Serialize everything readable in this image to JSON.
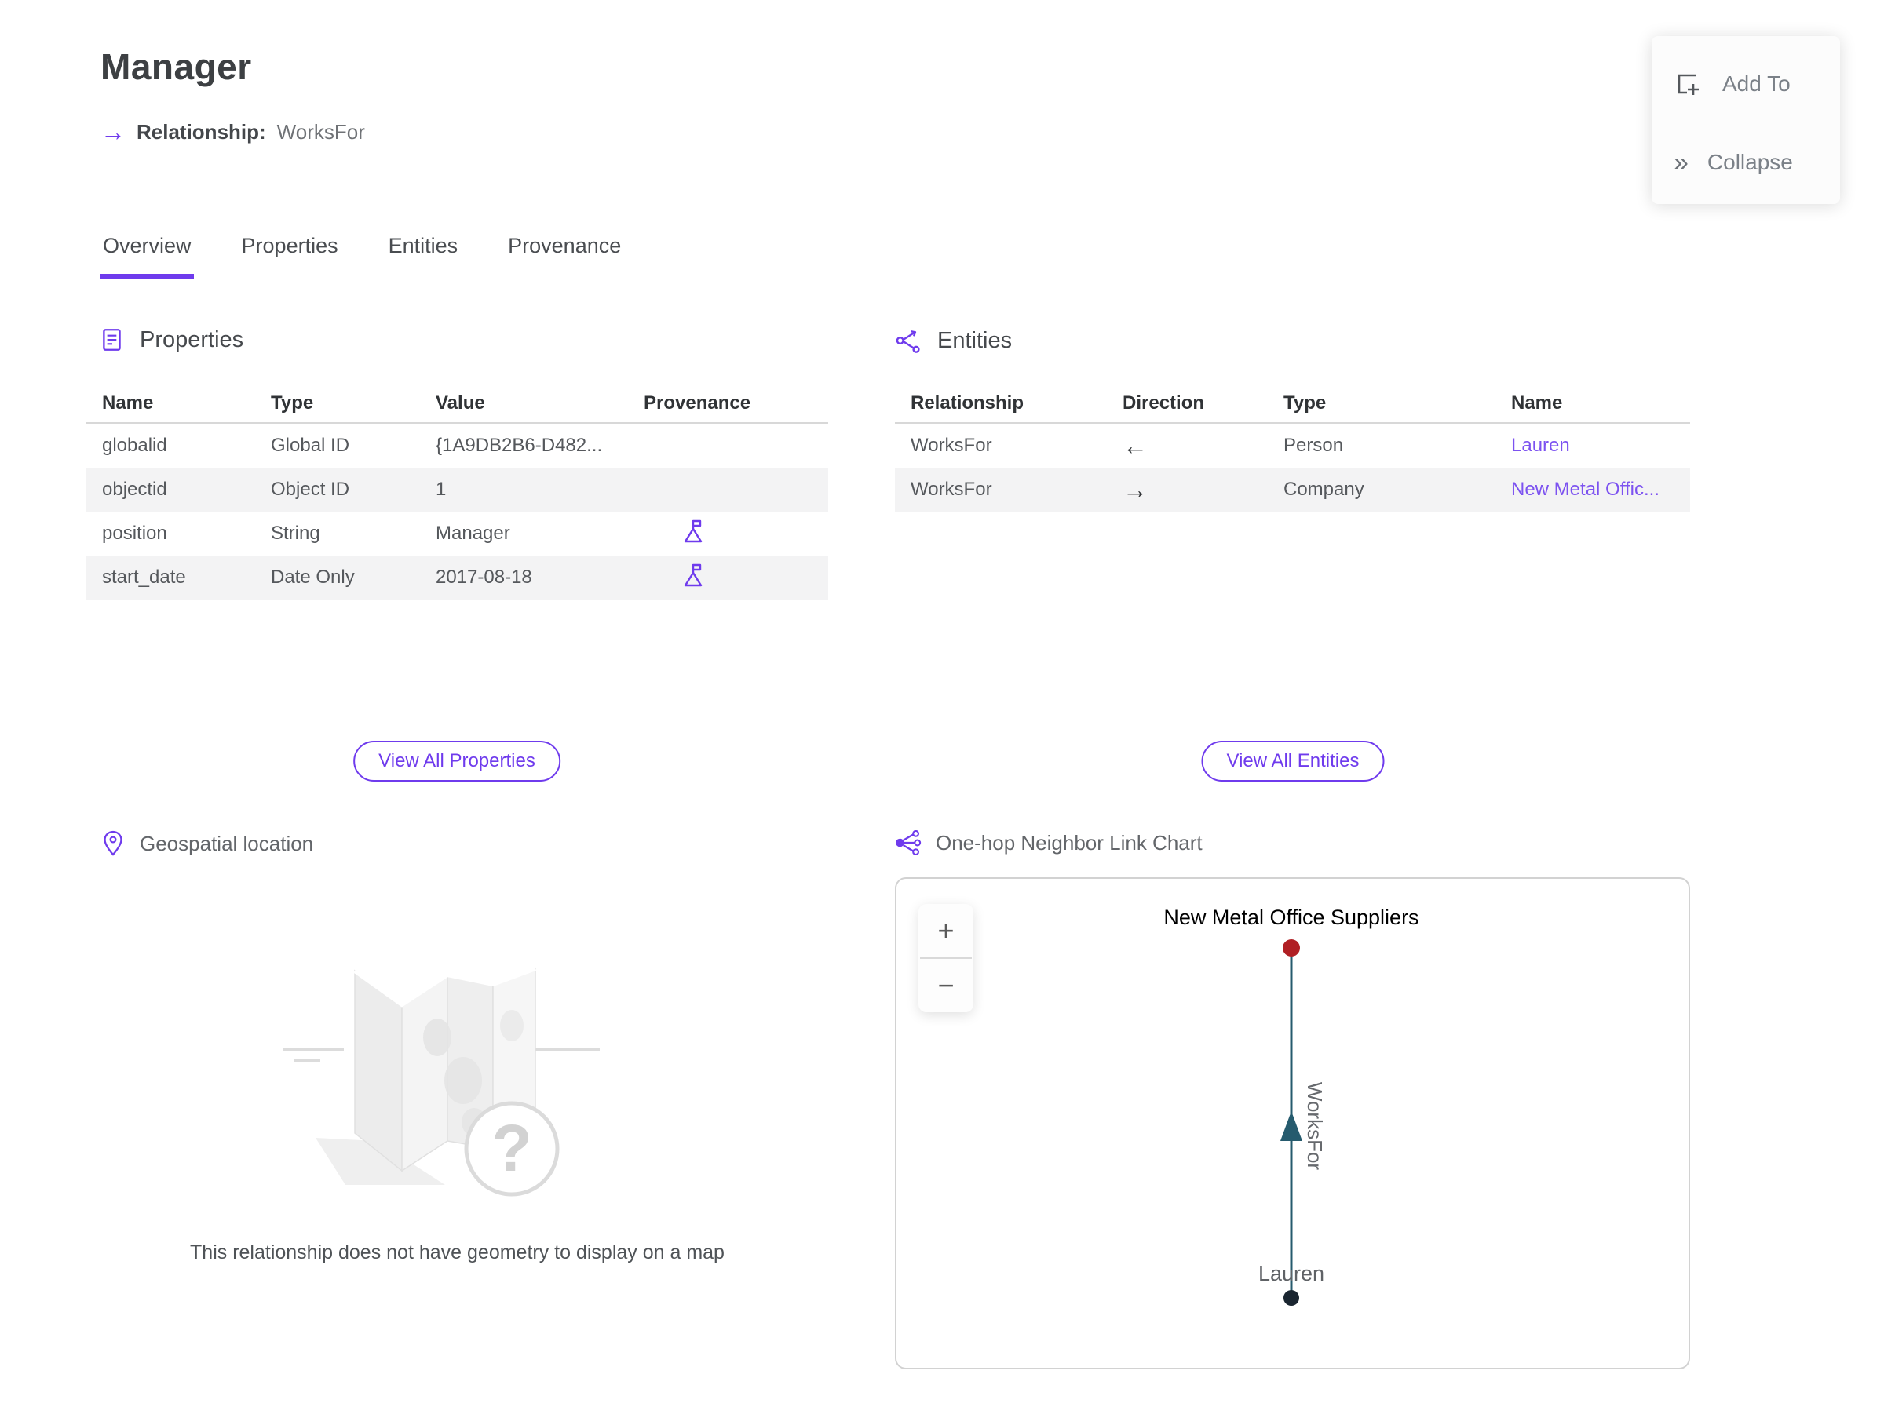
{
  "header": {
    "title": "Manager",
    "relationship_arrow": "→",
    "subtitle_label": "Relationship:",
    "subtitle_value": "WorksFor"
  },
  "floating_actions": {
    "add_to": "Add To",
    "collapse": "Collapse",
    "collapse_glyph": "»"
  },
  "tabs": [
    {
      "label": "Overview",
      "active": true
    },
    {
      "label": "Properties",
      "active": false
    },
    {
      "label": "Entities",
      "active": false
    },
    {
      "label": "Provenance",
      "active": false
    }
  ],
  "properties_section": {
    "title": "Properties",
    "columns": [
      "Name",
      "Type",
      "Value",
      "Provenance"
    ],
    "rows": [
      {
        "name": "globalid",
        "type": "Global ID",
        "value": "{1A9DB2B6-D482...",
        "has_provenance": false
      },
      {
        "name": "objectid",
        "type": "Object ID",
        "value": "1",
        "has_provenance": false
      },
      {
        "name": "position",
        "type": "String",
        "value": "Manager",
        "has_provenance": true
      },
      {
        "name": "start_date",
        "type": "Date Only",
        "value": "2017-08-18",
        "has_provenance": true
      }
    ],
    "view_all": "View All Properties"
  },
  "entities_section": {
    "title": "Entities",
    "columns": [
      "Relationship",
      "Direction",
      "Type",
      "Name"
    ],
    "rows": [
      {
        "relationship": "WorksFor",
        "direction": "←",
        "type": "Person",
        "name": "Lauren"
      },
      {
        "relationship": "WorksFor",
        "direction": "→",
        "type": "Company",
        "name": "New Metal Offic..."
      }
    ],
    "view_all": "View All Entities"
  },
  "geospatial_section": {
    "title": "Geospatial location",
    "placeholder_glyph": "?",
    "empty_message": "This relationship does not have geometry to display on a map"
  },
  "link_chart_section": {
    "title": "One-hop Neighbor Link Chart",
    "zoom_in": "+",
    "zoom_out": "−",
    "chart": {
      "top_node": {
        "label": "New Metal Office Suppliers",
        "color": "#b01f24"
      },
      "bottom_node": {
        "label": "Lauren",
        "color": "#1a2530"
      },
      "edge": {
        "label": "WorksFor",
        "color": "#265b6e",
        "direction": "up"
      }
    }
  },
  "colors": {
    "accent_purple": "#6f3bed",
    "link_purple": "#7c52f0",
    "edge_teal": "#265b6e",
    "node_red": "#b01f24",
    "node_dark": "#1a2530"
  }
}
